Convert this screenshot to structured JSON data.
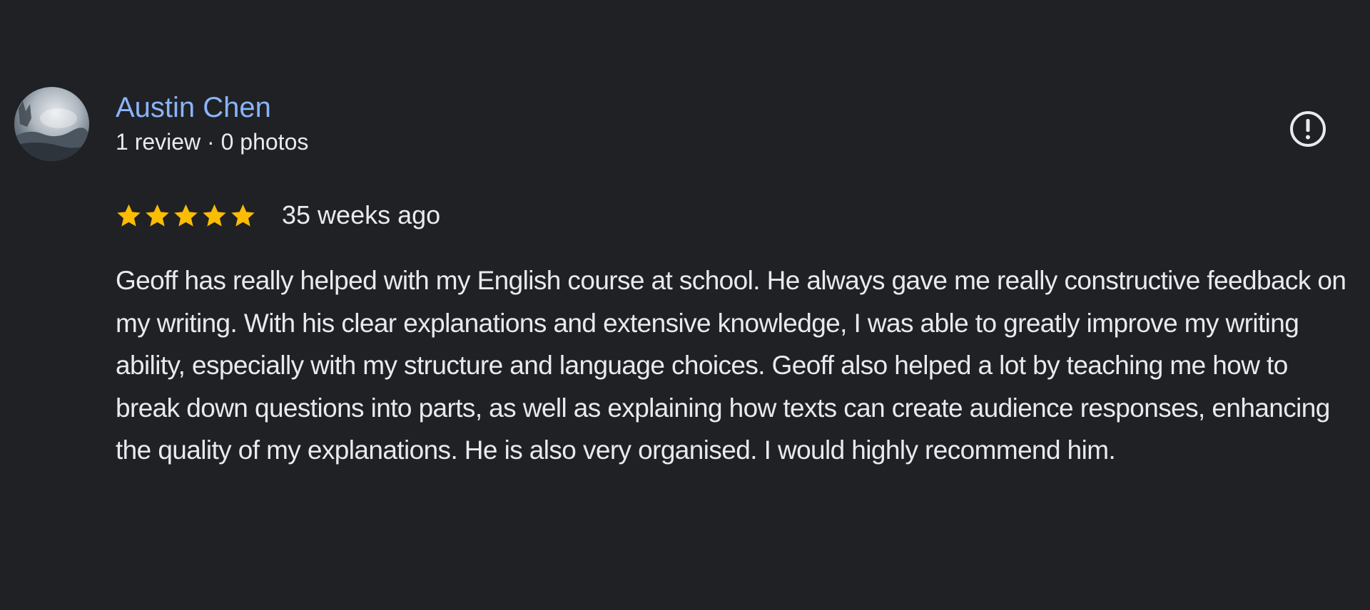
{
  "author": {
    "name": "Austin Chen",
    "meta": "1 review · 0 photos"
  },
  "avatar": {
    "icon": "user-photo-avatar"
  },
  "report": {
    "icon": "report-flag-icon"
  },
  "rating": {
    "stars": 5,
    "max": 5,
    "star_color": "#fbbc04",
    "time_ago": "35 weeks ago"
  },
  "review": {
    "text": "Geoff has really helped with my English course at school. He always gave me really constructive feedback on my writing. With his clear explanations and extensive knowledge, I was able to greatly improve my writing ability, especially with my structure and language choices. Geoff also helped a lot by teaching me how to break down questions into parts, as well as explaining how texts can create audience responses, enhancing the quality of my explanations. He is also very organised. I would highly recommend him."
  },
  "colors": {
    "background": "#202124",
    "link": "#8ab4f8",
    "text": "#e8eaed"
  }
}
